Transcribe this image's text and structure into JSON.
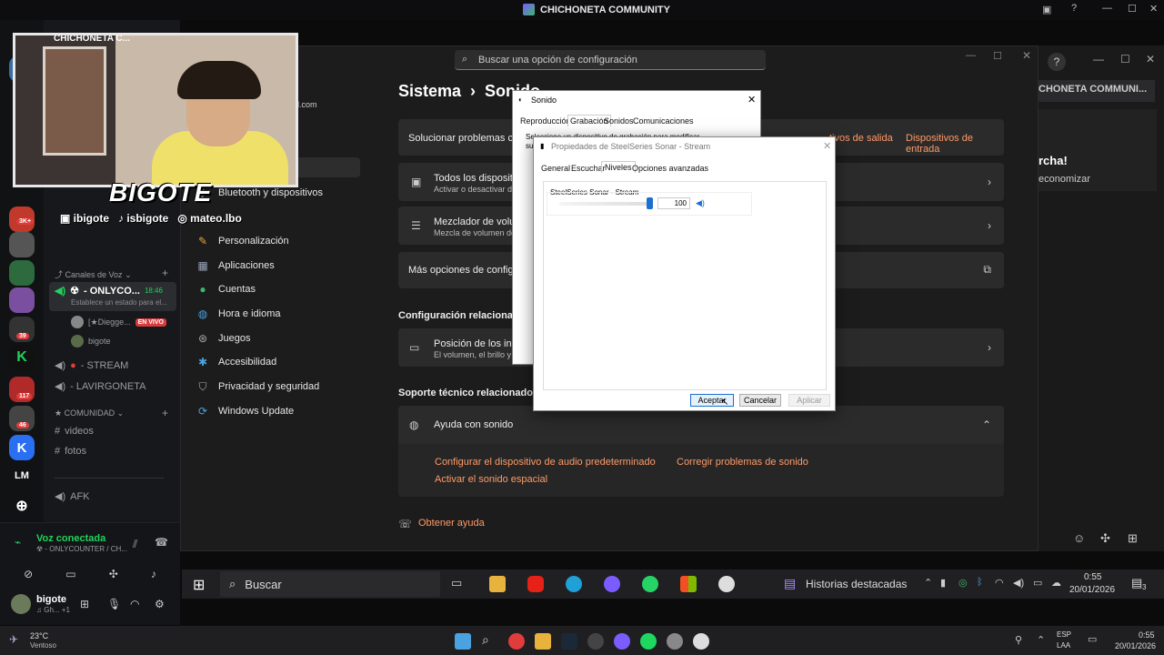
{
  "discord": {
    "title": "CHICHONETA COMMUNITY",
    "server_badges": [
      "3K+",
      "39",
      "117",
      "46"
    ],
    "server_letters": [
      "K",
      "LM"
    ],
    "categories": {
      "voice": "Canales de Voz",
      "comunidad": "COMUNIDAD"
    },
    "channels": [
      {
        "icon": "☢",
        "name": "- ONLYCO...",
        "time": "18:46",
        "status": "Establece un estado para el..."
      },
      {
        "name": "- STREAM"
      },
      {
        "name": "- LAVIRGONETA"
      },
      {
        "name": "videos"
      },
      {
        "name": "fotos"
      },
      {
        "name": "AFK"
      }
    ],
    "channel_users": [
      {
        "name": "[★Diegge...",
        "badge": "EN VIVO"
      },
      {
        "name": "bigote"
      }
    ],
    "voice_status": "Voz conectada",
    "voice_channel": "☢ - ONLYCOUNTER / CH...",
    "user": {
      "name": "bigote",
      "sub": "♫ Gh... +1"
    }
  },
  "overlay": {
    "brand": "BIGOTE",
    "socials": [
      "ibigote",
      "isbigote",
      "mateo.lbo"
    ],
    "cam_title": "CHICHONETA C..."
  },
  "settings": {
    "search_placeholder": "Buscar una opción de configuración",
    "breadcrumb_root": "Sistema",
    "breadcrumb_sep": "›",
    "breadcrumb_page": "Sonido",
    "partial_email": "ail.com",
    "nav": [
      {
        "icon": "bluetooth-icon",
        "label": "Bluetooth y dispositivos"
      },
      {
        "icon": "brush-icon",
        "label": "Personalización"
      },
      {
        "icon": "apps-icon",
        "label": "Aplicaciones"
      },
      {
        "icon": "person-icon",
        "label": "Cuentas"
      },
      {
        "icon": "globe-icon",
        "label": "Hora e idioma"
      },
      {
        "icon": "gamepad-icon",
        "label": "Juegos"
      },
      {
        "icon": "accessibility-icon",
        "label": "Accesibilidad"
      },
      {
        "icon": "shield-icon",
        "label": "Privacidad y seguridad"
      },
      {
        "icon": "update-icon",
        "label": "Windows Update"
      }
    ],
    "troubleshoot": "Solucionar problemas comu",
    "out_devices": "tivos de salida",
    "in_devices": "Dispositivos de entrada",
    "cards": [
      {
        "title": "Todos los dispositiv",
        "sub": "Activar o desactivar dispo"
      },
      {
        "title": "Mezclador de volum",
        "sub": "Mezcla de volumen de"
      },
      {
        "title": "Más opciones de configurac",
        "sub": ""
      }
    ],
    "related": "Configuración relacionada",
    "related_card": {
      "title": "Posición de los indica",
      "sub": "El volumen, el brillo y ot"
    },
    "support": "Soporte técnico relacionado",
    "help": "Ayuda con sonido",
    "links": [
      "Configurar el dispositivo de audio predeterminado",
      "Corregir problemas de sonido",
      "Activar el sonido espacial"
    ],
    "get_help": "Obtener ayuda"
  },
  "sonido_dialog": {
    "title": "Sonido",
    "tabs": [
      "Reproducción",
      "Grabación",
      "Sonidos",
      "Comunicaciones"
    ],
    "partial_text": "Seleccione un dispositivo de grabación para modificar su co"
  },
  "props_dialog": {
    "title": "Propiedades de SteelSeries Sonar - Stream",
    "tabs": [
      "General",
      "Escuchar",
      "Niveles",
      "Opciones avanzadas"
    ],
    "device": "SteelSeries Sonar - Stream",
    "level": "100",
    "level_fraction": 1.0,
    "buttons": {
      "ok": "Aceptar",
      "cancel": "Cancelar",
      "apply": "Aplicar"
    }
  },
  "right_pane": {
    "tab": "CHONETA COMMUNI...",
    "heading": "rcha!",
    "sub": "economizar"
  },
  "taskbar_inner": {
    "search": "Buscar",
    "highlights": "Historias destacadas",
    "time": "0:55",
    "date": "20/01/2026",
    "notif": "3"
  },
  "taskbar_outer": {
    "weather_temp": "23°C",
    "weather_desc": "Ventoso",
    "lang": "ESP",
    "lang_sub": "LAA",
    "time": "0:55",
    "date": "20/01/2026"
  }
}
